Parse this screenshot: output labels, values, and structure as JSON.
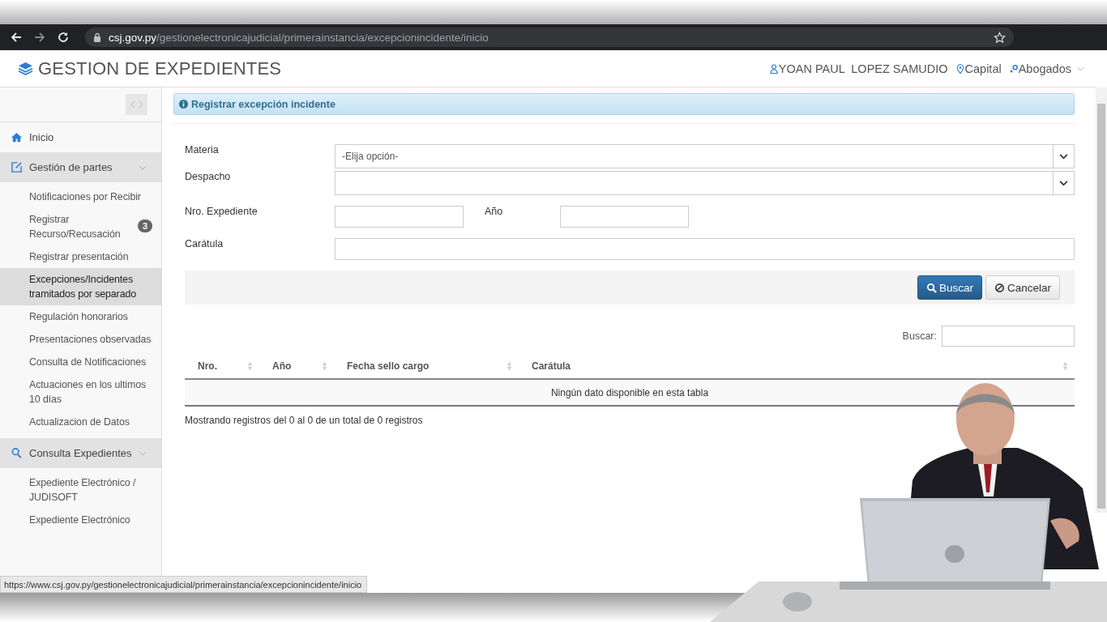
{
  "browser": {
    "url_host": "csj.gov.py",
    "url_path": "/gestionelectronicajudicial/primerainstancia/excepcionincidente/inicio",
    "starred": false
  },
  "header": {
    "title": "GESTION DE EXPEDIENTES",
    "user": "YOAN PAUL  LOPEZ SAMUDIO",
    "location": "Capital",
    "role": "Abogados"
  },
  "sidebar": {
    "items": [
      {
        "kind": "link",
        "label": "Inicio",
        "selected": false
      },
      {
        "kind": "section",
        "label": "Gestión de partes",
        "expanded": true,
        "children": [
          {
            "label": "Notificaciones por Recibir",
            "selected": false
          },
          {
            "label": "Registrar Recurso/Recusación",
            "selected": false,
            "badge": "3"
          },
          {
            "label": "Registrar presentación",
            "selected": false
          },
          {
            "label": "Excepciones/Incidentes tramitados por separado",
            "selected": true
          },
          {
            "label": "Regulación honorarios",
            "selected": false
          },
          {
            "label": "Presentaciones observadas",
            "selected": false
          },
          {
            "label": "Consulta de Notificaciones",
            "selected": false
          },
          {
            "label": "Actuaciones en los ultimos 10 días",
            "selected": false
          },
          {
            "label": "Actualizacion de Datos",
            "selected": false
          }
        ]
      },
      {
        "kind": "section",
        "label": "Consulta Expedientes",
        "expanded": true,
        "children": [
          {
            "label": "Expediente Electrónico / JUDISOFT",
            "selected": false
          },
          {
            "label": "Expediente Electrónico",
            "selected": false
          }
        ]
      }
    ]
  },
  "panel": {
    "title": "Registrar excepción incidente"
  },
  "form": {
    "materia": {
      "label": "Materia",
      "value": "-Elija opción-"
    },
    "despacho": {
      "label": "Despacho"
    },
    "expediente": {
      "label": "Nro. Expediente"
    },
    "anio": {
      "label": "Año"
    },
    "caratula": {
      "label": "Carátula"
    }
  },
  "buttons": [
    {
      "kind": "primary",
      "label": "Buscar"
    },
    {
      "kind": "default",
      "label": "Cancelar"
    }
  ],
  "table": {
    "search_label": "Buscar:",
    "columns": [
      "Nro.",
      "Año",
      "Fecha sello cargo",
      "Carátula"
    ],
    "empty": "Ningún dato disponible en esta tabla",
    "info": "Mostrando registros del 0 al 0 de un total de 0 registros"
  },
  "status_url": "https://www.csj.gov.py/gestionelectronicajudicial/primerainstancia/excepcionincidente/inicio"
}
